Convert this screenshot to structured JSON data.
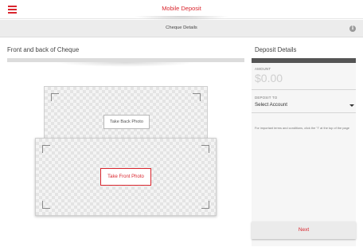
{
  "header": {
    "title": "Mobile Deposit"
  },
  "subheader": {
    "title": "Cheque Details",
    "info_icon": "i"
  },
  "left": {
    "heading": "Front and back of Cheque",
    "back_button": "Take Back Photo",
    "front_button": "Take Front Photo"
  },
  "right": {
    "heading": "Deposit Details",
    "amount_label": "AMOUNT",
    "amount_placeholder": "$0.00",
    "deposit_to_label": "DEPOSIT TO",
    "account_select": "Select Account",
    "terms": "For important terms and conditions, click the \"i\" at the top of the page",
    "next_button": "Next"
  },
  "colors": {
    "accent": "#d9262e",
    "icons": [
      "menu-icon",
      "info-icon",
      "chevron-down-icon"
    ]
  }
}
